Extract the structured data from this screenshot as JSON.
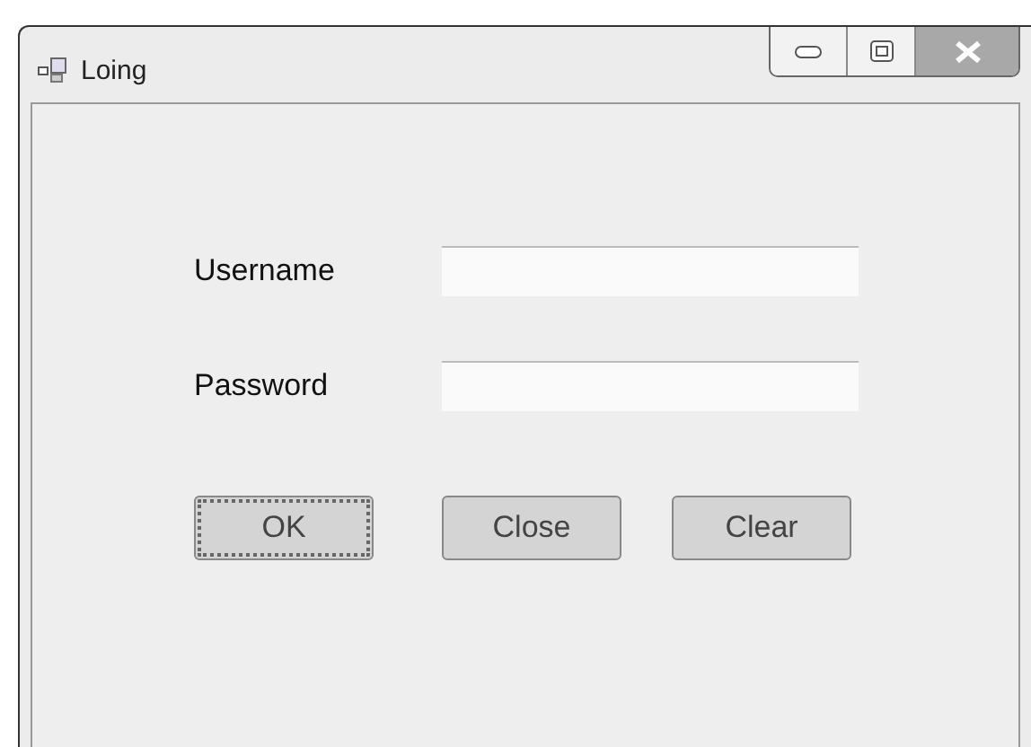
{
  "window": {
    "title": "Loing"
  },
  "fields": [
    {
      "label": "Username"
    },
    {
      "label": "Password"
    }
  ],
  "buttons": [
    {
      "label": "OK",
      "focused": true
    },
    {
      "label": "Close",
      "focused": false
    },
    {
      "label": "Clear",
      "focused": false
    }
  ]
}
